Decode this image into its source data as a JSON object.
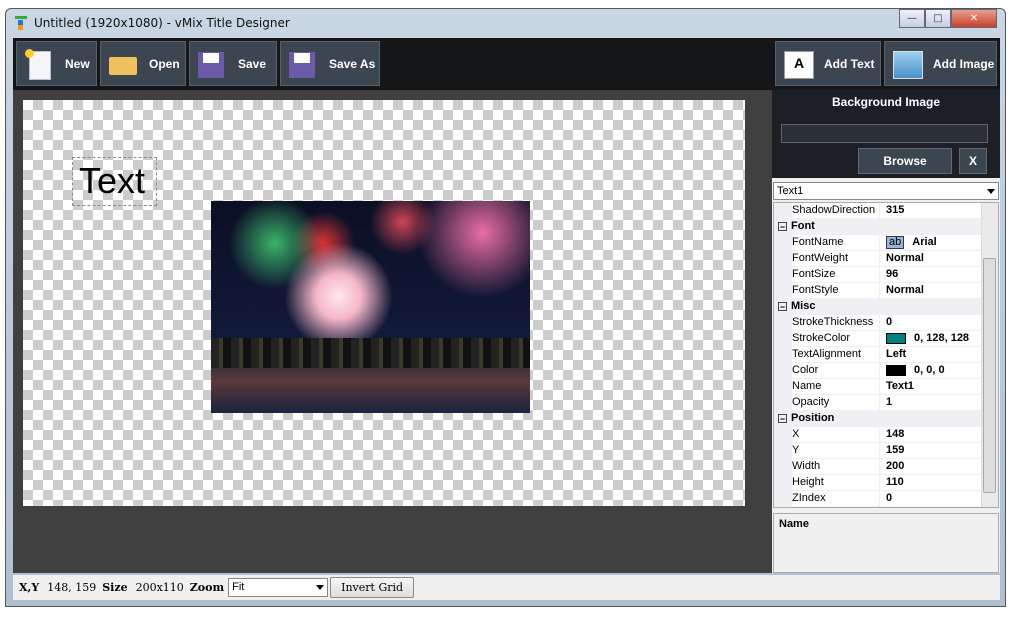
{
  "window": {
    "title": "Untitled (1920x1080) - vMix Title Designer"
  },
  "toolbar": {
    "new": "New",
    "open": "Open",
    "save": "Save",
    "save_as": "Save As",
    "add_text": "Add Text",
    "add_image": "Add Image"
  },
  "canvas": {
    "text_element": "Text"
  },
  "background": {
    "heading": "Background Image",
    "path": "",
    "browse": "Browse",
    "clear": "X"
  },
  "selector": {
    "selected": "Text1"
  },
  "properties": [
    {
      "type": "prop",
      "key": "ShadowDirection",
      "value": "315"
    },
    {
      "type": "cat",
      "key": "Font"
    },
    {
      "type": "prop",
      "key": "FontName",
      "value": "Arial",
      "preview": "ab"
    },
    {
      "type": "prop",
      "key": "FontWeight",
      "value": "Normal"
    },
    {
      "type": "prop",
      "key": "FontSize",
      "value": "96"
    },
    {
      "type": "prop",
      "key": "FontStyle",
      "value": "Normal"
    },
    {
      "type": "cat",
      "key": "Misc"
    },
    {
      "type": "prop",
      "key": "StrokeThickness",
      "value": "0"
    },
    {
      "type": "prop",
      "key": "StrokeColor",
      "value": "0, 128, 128",
      "swatch": "#008080"
    },
    {
      "type": "prop",
      "key": "TextAlignment",
      "value": "Left"
    },
    {
      "type": "prop",
      "key": "Color",
      "value": "0, 0, 0",
      "swatch": "#000000"
    },
    {
      "type": "prop",
      "key": "Name",
      "value": "Text1"
    },
    {
      "type": "prop",
      "key": "Opacity",
      "value": "1"
    },
    {
      "type": "cat",
      "key": "Position"
    },
    {
      "type": "prop",
      "key": "X",
      "value": "148"
    },
    {
      "type": "prop",
      "key": "Y",
      "value": "159"
    },
    {
      "type": "prop",
      "key": "Width",
      "value": "200"
    },
    {
      "type": "prop",
      "key": "Height",
      "value": "110"
    },
    {
      "type": "prop",
      "key": "ZIndex",
      "value": "0"
    }
  ],
  "description": {
    "title": "Name"
  },
  "status": {
    "xy_label": "X,Y",
    "xy": "148, 159",
    "size_label": "Size",
    "size": "200x110",
    "zoom_label": "Zoom",
    "zoom": "Fit",
    "invert": "Invert Grid"
  }
}
